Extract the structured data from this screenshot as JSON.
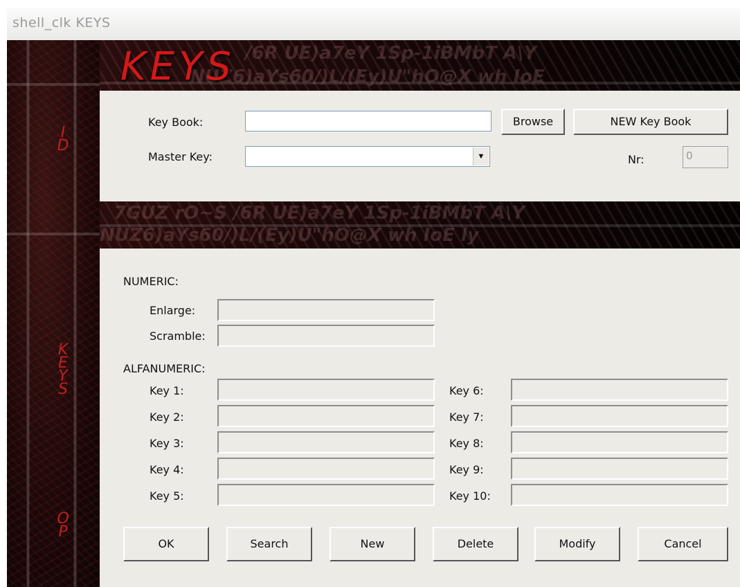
{
  "window": {
    "title": "shell_clk KEYS"
  },
  "header": {
    "title": "KEYS"
  },
  "side_labels": {
    "id": [
      "I",
      "D"
    ],
    "keys": [
      "K",
      "E",
      "Y",
      "S"
    ],
    "op": [
      "O",
      "P"
    ]
  },
  "keybook": {
    "label": "Key Book:",
    "value": "",
    "browse_label": "Browse",
    "new_label": "NEW Key Book"
  },
  "masterkey": {
    "label": "Master Key:",
    "value": ""
  },
  "nr": {
    "label": "Nr:",
    "value": "0"
  },
  "numeric": {
    "heading": "NUMERIC:",
    "enlarge_label": "Enlarge:",
    "scramble_label": "Scramble:"
  },
  "alfanumeric": {
    "heading": "ALFANUMERIC:",
    "keys": [
      "Key 1:",
      "Key 2:",
      "Key 3:",
      "Key 4:",
      "Key 5:",
      "Key 6:",
      "Key 7:",
      "Key 8:",
      "Key 9:",
      "Key 10:"
    ]
  },
  "buttons": {
    "ok": "OK",
    "search": "Search",
    "new": "New",
    "delete": "Delete",
    "modify": "Modify",
    "cancel": "Cancel"
  }
}
